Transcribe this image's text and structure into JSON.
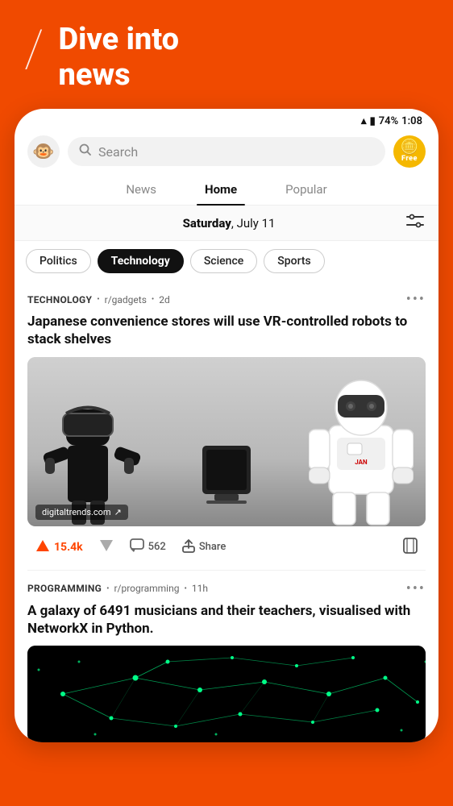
{
  "header": {
    "slash": "/",
    "title_line1": "Dive into",
    "title_line2": "news"
  },
  "status_bar": {
    "battery": "74%",
    "time": "1:08"
  },
  "search": {
    "placeholder": "Search"
  },
  "free_badge": "Free",
  "nav": {
    "tabs": [
      {
        "label": "News",
        "active": false
      },
      {
        "label": "Home",
        "active": true
      },
      {
        "label": "Popular",
        "active": false
      }
    ]
  },
  "date_bar": {
    "day": "Saturday",
    "date": "July 11"
  },
  "categories": [
    {
      "label": "Politics",
      "active": false
    },
    {
      "label": "Technology",
      "active": true
    },
    {
      "label": "Science",
      "active": false
    },
    {
      "label": "Sports",
      "active": false
    }
  ],
  "post1": {
    "category": "TECHNOLOGY",
    "subreddit": "r/gadgets",
    "time": "2d",
    "title": "Japanese convenience stores will use VR-controlled robots to stack shelves",
    "image_source": "digitaltrends.com",
    "upvotes": "15.4k",
    "comments": "562",
    "share_label": "Share"
  },
  "post2": {
    "category": "PROGRAMMING",
    "subreddit": "r/programming",
    "time": "11h",
    "title": "A galaxy of 6491 musicians and their teachers, visualised with NetworkX in Python."
  }
}
